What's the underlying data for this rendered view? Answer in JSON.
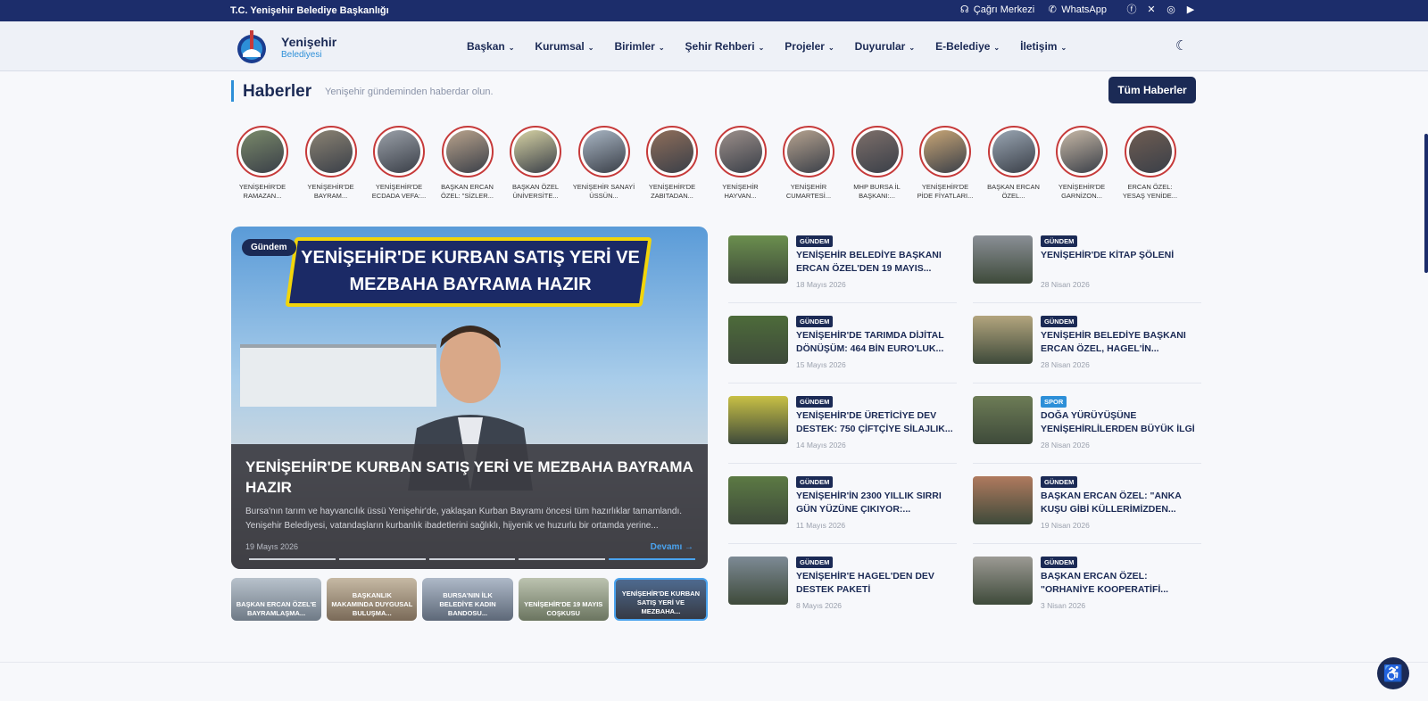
{
  "topbar": {
    "title": "T.C. Yenişehir Belediye Başkanlığı",
    "call_center": "Çağrı Merkezi",
    "whatsapp": "WhatsApp",
    "social_icons": [
      "facebook-icon",
      "x-icon",
      "instagram-icon",
      "youtube-icon"
    ]
  },
  "brand": {
    "name": "Yenişehir",
    "sub": "Belediyesi"
  },
  "menu": [
    "Başkan",
    "Kurumsal",
    "Birimler",
    "Şehir Rehberi",
    "Projeler",
    "Duyurular",
    "E-Belediye",
    "İletişim"
  ],
  "section": {
    "title": "Haberler",
    "subtitle": "Yenişehir gündeminden haberdar olun.",
    "all_button": "Tüm Haberler"
  },
  "stories": [
    "YENİŞEHİR'DE RAMAZAN...",
    "YENİŞEHİR'DE BAYRAM...",
    "YENİŞEHİR'DE ECDADA VEFA:...",
    "BAŞKAN ERCAN ÖZEL: \"SİZLER...",
    "BAŞKAN ÖZEL ÜNİVERSİTE...",
    "YENİŞEHİR SANAYİ ÜSSÜN...",
    "YENİŞEHİR'DE ZABITADAN...",
    "YENİŞEHİR HAYVAN...",
    "YENİŞEHİR CUMARTESİ...",
    "MHP BURSA İL BAŞKANI:...",
    "YENİŞEHİR'DE PİDE FİYATLARI...",
    "BAŞKAN ERCAN ÖZEL...",
    "YENİŞEHİR'DE GARNİZON...",
    "ERCAN ÖZEL: YESAŞ YENİDE..."
  ],
  "hero": {
    "tag": "Gündem",
    "banner": "YENİŞEHİR'DE KURBAN SATIŞ YERİ VE MEZBAHA BAYRAMA HAZIR",
    "title": "YENİŞEHİR'DE KURBAN SATIŞ YERİ VE MEZBAHA BAYRAMA HAZIR",
    "desc": "Bursa'nın tarım ve hayvancılık üssü Yenişehir'de, yaklaşan Kurban Bayramı öncesi tüm hazırlıklar tamamlandı. Yenişehir Belediyesi, vatandaşların kurbanlık ibadetlerini sağlıklı, hijyenik ve huzurlu bir ortamda yerine...",
    "date": "19 Mayıs 2026",
    "more": "Devamı →"
  },
  "thumbs": [
    "BAŞKAN ERCAN ÖZEL'E BAYRAMLAŞMA...",
    "BAŞKANLIK MAKAMINDA DUYGUSAL BULUŞMA...",
    "BURSA'NIN İLK BELEDİYE KADIN BANDOSU...",
    "YENİŞEHİR'DE 19 MAYIS COŞKUSU",
    "YENİŞEHİR'DE KURBAN SATIŞ YERİ VE MEZBAHA..."
  ],
  "news_left": [
    {
      "badge": "GÜNDEM",
      "title": "YENİŞEHİR BELEDİYE BAŞKANI ERCAN ÖZEL'DEN 19 MAYIS...",
      "date": "18 Mayıs 2026"
    },
    {
      "badge": "GÜNDEM",
      "title": "YENİŞEHİR'DE TARIMDA DİJİTAL DÖNÜŞÜM: 464 BİN EURO'LUK...",
      "date": "15 Mayıs 2026"
    },
    {
      "badge": "GÜNDEM",
      "title": "YENİŞEHİR'DE ÜRETİCİYE DEV DESTEK: 750 ÇİFTÇİYE SİLAJLIK...",
      "date": "14 Mayıs 2026"
    },
    {
      "badge": "GÜNDEM",
      "title": "YENİŞEHİR'İN 2300 YILLIK SIRRI GÜN YÜZÜNE ÇIKIYOR:...",
      "date": "11 Mayıs 2026"
    },
    {
      "badge": "GÜNDEM",
      "title": "YENİŞEHİR'E HAGEL'DEN DEV DESTEK PAKETİ",
      "date": "8 Mayıs 2026"
    }
  ],
  "news_right": [
    {
      "badge": "GÜNDEM",
      "title": "YENİŞEHİR'DE KİTAP ŞÖLENİ",
      "date": "28 Nisan 2026"
    },
    {
      "badge": "GÜNDEM",
      "title": "YENİŞEHİR BELEDİYE BAŞKANI ERCAN ÖZEL, HAGEL'İN...",
      "date": "28 Nisan 2026"
    },
    {
      "badge": "SPOR",
      "title": "DOĞA YÜRÜYÜŞÜNE YENİŞEHİRLİLERDEN BÜYÜK İLGİ",
      "date": "28 Nisan 2026"
    },
    {
      "badge": "GÜNDEM",
      "title": "BAŞKAN ERCAN ÖZEL: \"ANKA KUŞU GİBİ KÜLLERİMİZDEN...",
      "date": "19 Nisan 2026"
    },
    {
      "badge": "GÜNDEM",
      "title": "BAŞKAN ERCAN ÖZEL: \"ORHANİYE KOOPERATİFİ...",
      "date": "3 Nisan 2026"
    }
  ]
}
